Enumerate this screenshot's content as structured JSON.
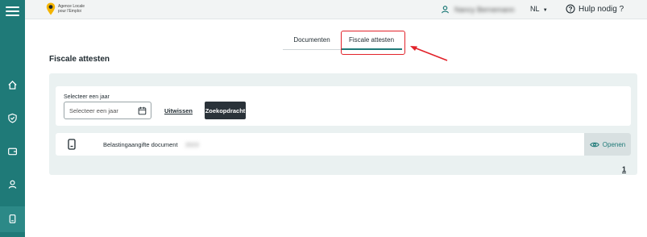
{
  "app": {
    "logo_line1": "Agence Locale",
    "logo_line2": "pour l'Emploi"
  },
  "header": {
    "user_name": "Nancy Bernemann",
    "language": "NL",
    "help_label": "Hulp nodig ?"
  },
  "tabs": [
    {
      "label": "Documenten",
      "active": false
    },
    {
      "label": "Fiscale attesten",
      "active": true
    }
  ],
  "page": {
    "title": "Fiscale attesten"
  },
  "filter": {
    "label": "Selecteer een jaar",
    "placeholder": "Selecteer een jaar",
    "clear_label": "Uitwissen",
    "search_label": "Zoekopdracht"
  },
  "documents": [
    {
      "name": "Belastingaangifte document",
      "year": "2023",
      "open_label": "Openen"
    }
  ],
  "pagination": {
    "current_page": "1"
  },
  "colors": {
    "accent": "#1f7a78",
    "annotation": "#e2222a",
    "panel": "#eaf1f1"
  }
}
